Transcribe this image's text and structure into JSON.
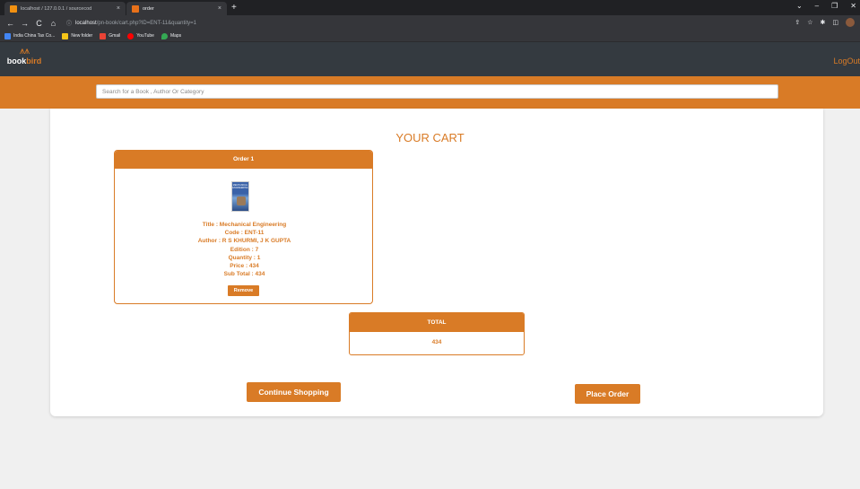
{
  "browser": {
    "tabs": [
      {
        "title": "localhost / 127.0.0.1 / sourcecod",
        "close": "×",
        "favicon_color": "#f29111"
      },
      {
        "title": "order",
        "close": "×",
        "favicon_color": "#e8711a"
      }
    ],
    "new_tab": "+",
    "window_controls": [
      "⌄",
      "–",
      "❐",
      "✕"
    ],
    "nav": {
      "back": "←",
      "forward": "→",
      "reload": "C",
      "home": "⌂"
    },
    "address": {
      "info_icon": "ⓘ",
      "host": "localhost",
      "path": "/pn-book/cart.php?ID=ENT-11&quantity=1"
    },
    "toolbar_icons": [
      "⇪",
      "☆",
      "✱",
      "◫"
    ],
    "bookmarks": [
      {
        "label": "India China Tax Co...",
        "color": "#4285f4"
      },
      {
        "label": "New folder",
        "color": "#f5c518"
      },
      {
        "label": "Gmail",
        "color": "#ea4335"
      },
      {
        "label": "YouTube",
        "color": "#ff0000"
      },
      {
        "label": "Maps",
        "color": "#34a853"
      }
    ]
  },
  "site": {
    "logo_text_a": "book",
    "logo_text_b": "bird",
    "logout": "LogOut",
    "search_placeholder": "Search for a Book , Author Or Category"
  },
  "cart": {
    "title": "YOUR CART",
    "orders": [
      {
        "header": "Order 1",
        "cover_text": "MECHANICAL ENGINEERING",
        "title_line": "Title : Mechanical Engineering",
        "code_line": "Code : ENT-11",
        "author_line": "Author : R S KHURMI, J K GUPTA",
        "edition_line": "Edition : 7",
        "quantity_line": "Quantity : 1",
        "price_line": "Price : 434",
        "subtotal_line": "Sub Total : 434",
        "remove_label": "Remove"
      }
    ],
    "total_header": "TOTAL",
    "total_value": "434",
    "continue_label": "Continue Shopping",
    "place_order_label": "Place Order"
  },
  "colors": {
    "accent": "#d97b26",
    "header_dark": "#343a40",
    "page_bg": "#f0f0f0"
  }
}
